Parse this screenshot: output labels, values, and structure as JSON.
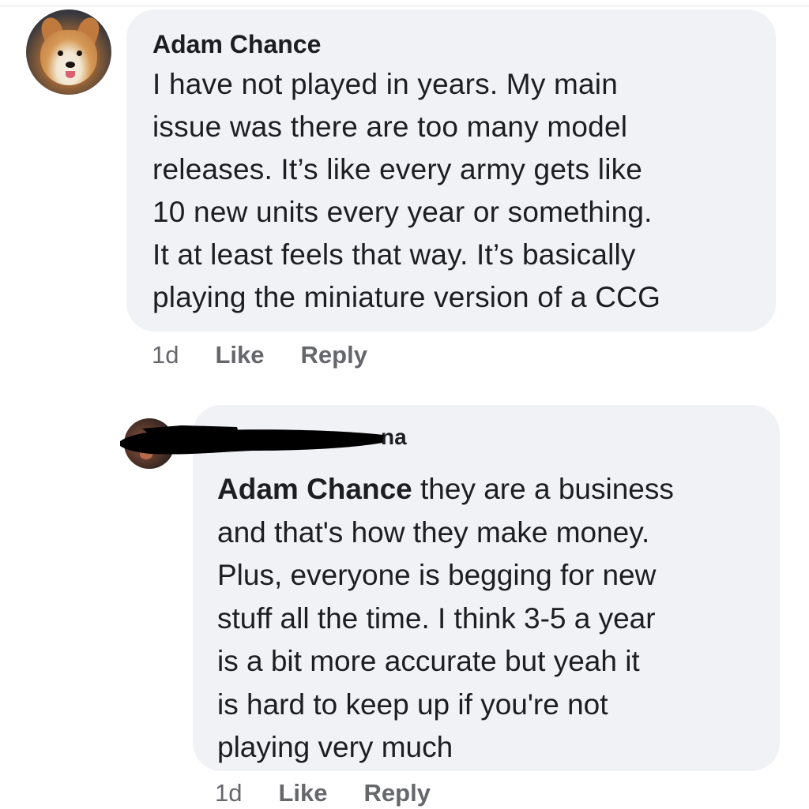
{
  "comments": [
    {
      "author": "Adam Chance",
      "text": "I have not played in years. My main issue was there are too many model releases. It’s like every army gets like 10 new units every year or something. It at least feels that way. It’s basically playing the miniature version of a CCG",
      "lines": [
        "I have not played in years. My main",
        "issue was there are too many model",
        "releases. It’s like every army gets like",
        "10 new units every year or something.",
        "It at least feels that way. It’s basically",
        "playing the miniature version of a CCG"
      ],
      "time": "1d",
      "like_label": "Like",
      "reply_label": "Reply"
    },
    {
      "author_visible_fragment": "na",
      "mention": "Adam Chance",
      "lines": [
        " they are a business",
        "and that's how they make money.",
        "Plus, everyone is begging for new",
        "stuff all the time. I think 3-5 a year",
        "is a bit more accurate but yeah it",
        "is hard to keep up if you're not",
        "playing very much"
      ],
      "time": "1d",
      "like_label": "Like",
      "reply_label": "Reply"
    }
  ],
  "colors": {
    "bubble_bg": "#f0f2f5",
    "text": "#1c1e21",
    "secondary_text": "#65676b",
    "redaction": "#000000"
  }
}
